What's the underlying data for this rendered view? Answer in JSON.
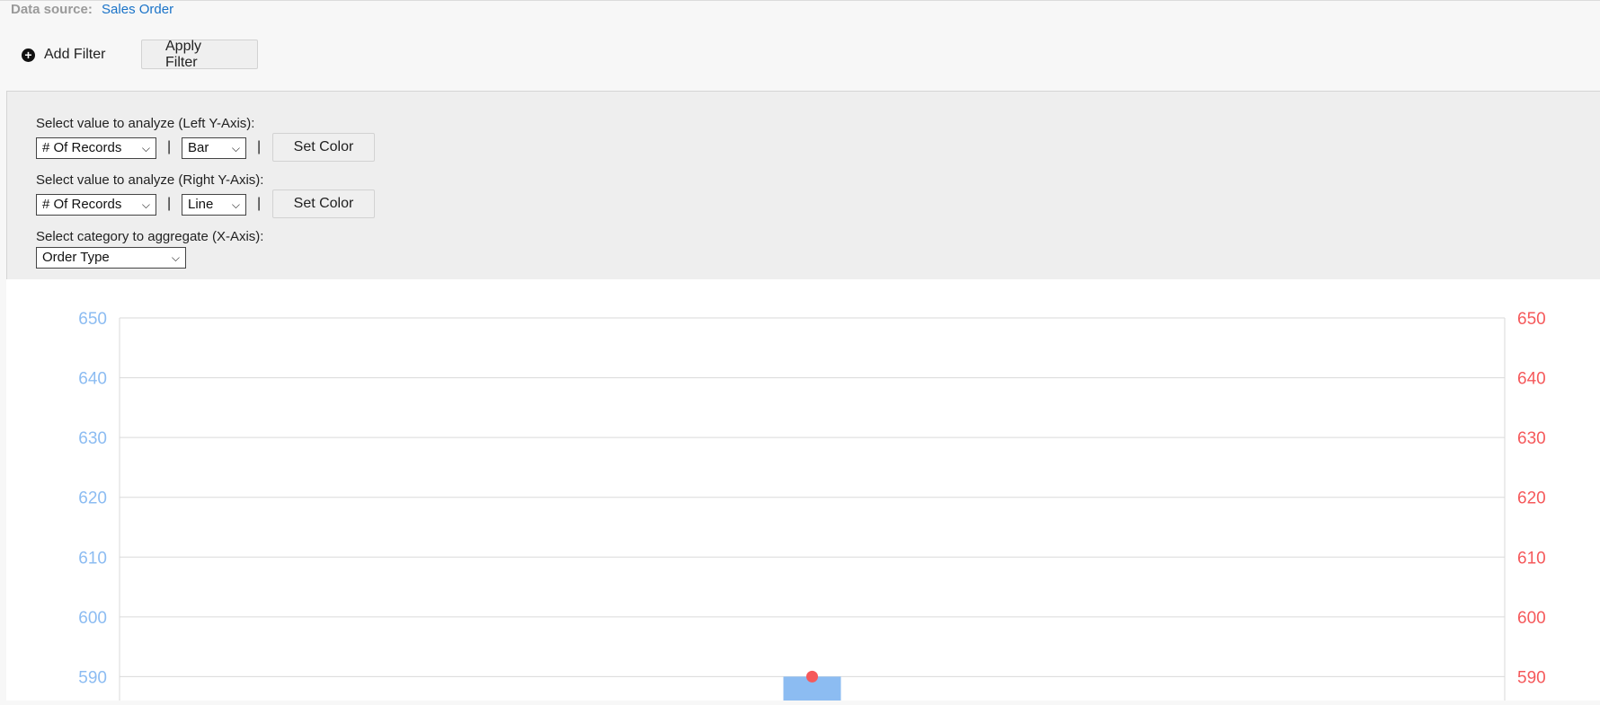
{
  "data_source": {
    "label": "Data source:",
    "value": "Sales Order"
  },
  "filter_bar": {
    "add_filter": "Add Filter",
    "apply_filter": "Apply Filter"
  },
  "config": {
    "left_axis": {
      "label": "Select value to analyze (Left Y-Axis):",
      "value": "# Of Records",
      "chart_type": "Bar",
      "set_color": "Set Color"
    },
    "right_axis": {
      "label": "Select value to analyze (Right Y-Axis):",
      "value": "# Of Records",
      "chart_type": "Line",
      "set_color": "Set Color"
    },
    "x_axis": {
      "label": "Select category to aggregate (X-Axis):",
      "value": "Order Type"
    },
    "separator": "|"
  },
  "colors": {
    "left_axis": "#8cbcf2",
    "right_axis": "#f5595b",
    "bar": "#8cbcf2",
    "point": "#f5595b"
  },
  "chart_data": {
    "type": "bar",
    "left_y": {
      "ticks": [
        590,
        600,
        610,
        620,
        630,
        640,
        650
      ],
      "range": [
        586,
        650
      ]
    },
    "right_y": {
      "ticks": [
        590,
        600,
        610,
        620,
        630,
        640,
        650
      ],
      "range": [
        586,
        650
      ]
    },
    "categories": [
      ""
    ],
    "series": [
      {
        "type": "bar",
        "axis": "left",
        "values": [
          590
        ]
      },
      {
        "type": "line",
        "axis": "right",
        "values": [
          590
        ]
      }
    ],
    "grid": true
  }
}
